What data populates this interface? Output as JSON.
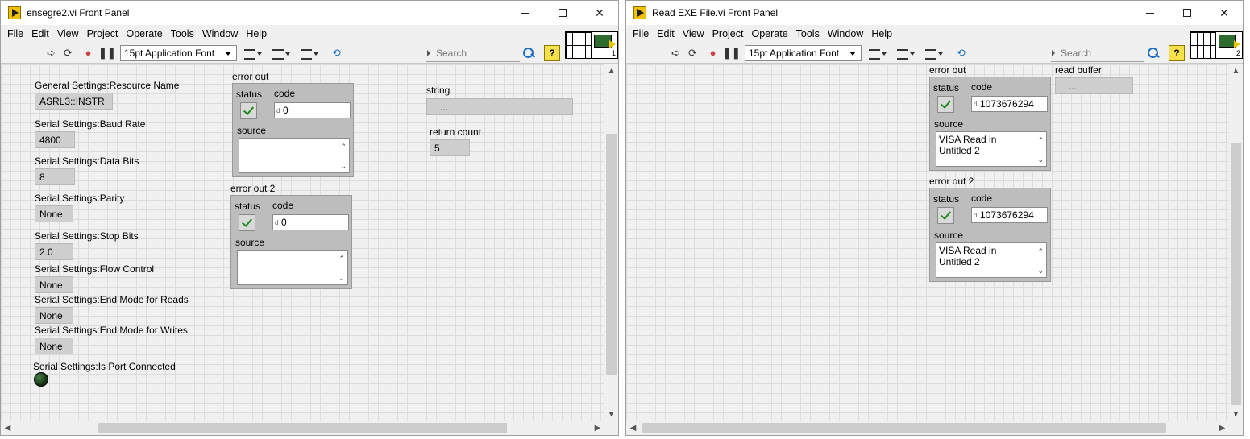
{
  "window1": {
    "title": "ensegre2.vi Front Panel",
    "menu": [
      "File",
      "Edit",
      "View",
      "Project",
      "Operate",
      "Tools",
      "Window",
      "Help"
    ],
    "toolbar": {
      "font": "15pt Application Font",
      "search_placeholder": "Search",
      "help": "?"
    },
    "vi_icon_number": "1",
    "controls": {
      "resource_name": {
        "label": "General Settings:Resource Name",
        "value": "ASRL3::INSTR"
      },
      "baud_rate": {
        "label": "Serial Settings:Baud Rate",
        "value": "4800"
      },
      "data_bits": {
        "label": "Serial Settings:Data Bits",
        "value": "8"
      },
      "parity": {
        "label": "Serial Settings:Parity",
        "value": "None"
      },
      "stop_bits": {
        "label": "Serial Settings:Stop Bits",
        "value": "2.0"
      },
      "flow_control": {
        "label": "Serial Settings:Flow Control",
        "value": "None"
      },
      "end_mode_reads": {
        "label": "Serial Settings:End Mode for Reads",
        "value": "None"
      },
      "end_mode_writes": {
        "label": "Serial Settings:End Mode for Writes",
        "value": "None"
      },
      "is_port_connected": {
        "label": "Serial Settings:Is Port Connected"
      },
      "string": {
        "label": "string",
        "value": "..."
      },
      "return_count": {
        "label": "return count",
        "value": "5"
      }
    },
    "error_out": {
      "label": "error out",
      "status_label": "status",
      "code_label": "code",
      "code": "0",
      "source_label": "source",
      "source": ""
    },
    "error_out_2": {
      "label": "error out 2",
      "status_label": "status",
      "code_label": "code",
      "code": "0",
      "source_label": "source",
      "source": ""
    }
  },
  "window2": {
    "title": "Read EXE File.vi Front Panel",
    "menu": [
      "File",
      "Edit",
      "View",
      "Project",
      "Operate",
      "Tools",
      "Window",
      "Help"
    ],
    "toolbar": {
      "font": "15pt Application Font",
      "search_placeholder": "Search",
      "help": "?"
    },
    "vi_icon_number": "2",
    "read_buffer": {
      "label": "read buffer",
      "value": "..."
    },
    "error_out": {
      "label": "error out",
      "status_label": "status",
      "code_label": "code",
      "code": "1073676294",
      "source_label": "source",
      "source": "VISA Read in Untitled 2"
    },
    "error_out_2": {
      "label": "error out 2",
      "status_label": "status",
      "code_label": "code",
      "code": "1073676294",
      "source_label": "source",
      "source": "VISA Read in Untitled 2"
    }
  }
}
